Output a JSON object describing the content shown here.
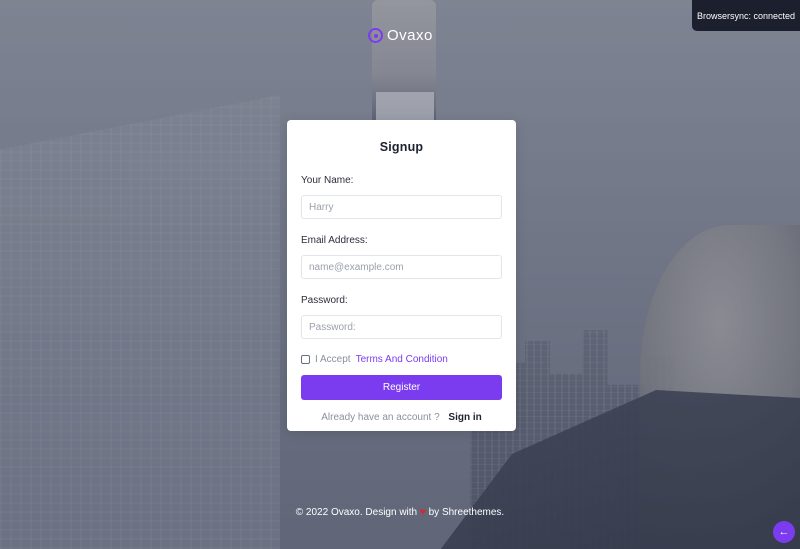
{
  "browsersync": {
    "text": "Browsersync: connected"
  },
  "brand": {
    "name": "Ovaxo"
  },
  "form": {
    "title": "Signup",
    "name_label": "Your Name:",
    "name_placeholder": "Harry",
    "email_label": "Email Address:",
    "email_placeholder": "name@example.com",
    "password_label": "Password:",
    "password_placeholder": "Password:",
    "terms_prefix": "I Accept",
    "terms_link": "Terms And Condition",
    "submit_label": "Register",
    "signin_prompt": "Already have an account ?",
    "signin_link": "Sign in"
  },
  "footer": {
    "prefix": "© 2022 Ovaxo. Design with",
    "heart_icon": "heart-icon",
    "suffix": "by Shreethemes."
  },
  "back_to_top": {
    "icon": "arrow-left-icon"
  },
  "colors": {
    "accent": "#7b3cf0",
    "heart": "#e02424",
    "browsersync_bg": "#1c1f2e"
  }
}
